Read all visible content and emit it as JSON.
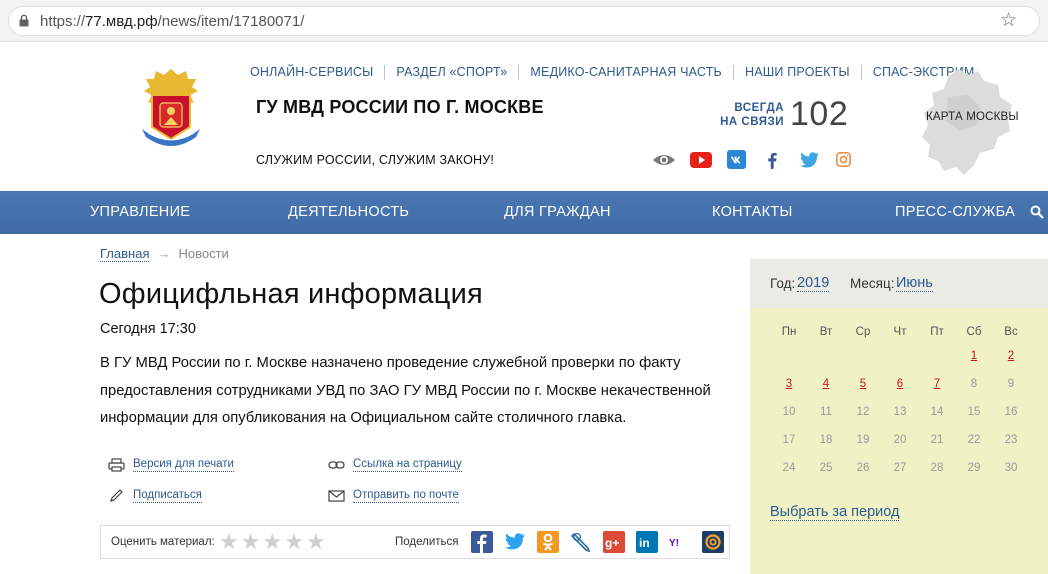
{
  "browser": {
    "url_scheme": "https://",
    "url_host": "77.мвд.рф",
    "url_path": "/news/item/17180071/"
  },
  "header": {
    "top_links": [
      "ОНЛАЙН-СЕРВИСЫ",
      "РАЗДЕЛ «СПОРТ»",
      "МЕДИКО-САНИТАРНАЯ ЧАСТЬ",
      "НАШИ ПРОЕКТЫ",
      "СПАС-ЭКСТРИМ"
    ],
    "title": "ГУ МВД РОССИИ ПО Г. МОСКВЕ",
    "motto": "СЛУЖИМ РОССИИ, СЛУЖИМ ЗАКОНУ!",
    "always_line1": "ВСЕГДА",
    "always_line2": "НА СВЯЗИ",
    "phone": "102",
    "map_label": "КАРТА МОСКВЫ"
  },
  "nav": {
    "items": [
      "УПРАВЛЕНИЕ",
      "ДЕЯТЕЛЬНОСТЬ",
      "ДЛЯ ГРАЖДАН",
      "КОНТАКТЫ",
      "ПРЕСС-СЛУЖБА"
    ]
  },
  "breadcrumb": {
    "home": "Главная",
    "arrow": "→",
    "current": "Новости"
  },
  "article": {
    "title": "Официфльная информация",
    "date": "Сегодня 17:30",
    "body": "В ГУ МВД России по г. Москве назначено проведение служебной проверки по факту предоставления сотрудниками УВД по ЗАО ГУ МВД России по г. Москве некачественной информации для опубликования на Официальном сайте столичного главка."
  },
  "actions": {
    "print": "Версия для печати",
    "link": "Ссылка на страницу",
    "subscribe": "Подписаться",
    "email": "Отправить по почте"
  },
  "rating": {
    "label": "Оценить материал:",
    "stars": 5,
    "share_label": "Поделиться"
  },
  "calendar": {
    "year_label": "Год:",
    "year": "2019",
    "month_label": "Месяц:",
    "month": "Июнь",
    "weekdays": [
      "Пн",
      "Вт",
      "Ср",
      "Чт",
      "Пт",
      "Сб",
      "Вс"
    ],
    "weeks": [
      [
        "",
        "",
        "",
        "",
        "",
        "1",
        "2"
      ],
      [
        "3",
        "4",
        "5",
        "6",
        "7",
        "8",
        "9"
      ],
      [
        "10",
        "11",
        "12",
        "13",
        "14",
        "15",
        "16"
      ],
      [
        "17",
        "18",
        "19",
        "20",
        "21",
        "22",
        "23"
      ],
      [
        "24",
        "25",
        "26",
        "27",
        "28",
        "29",
        "30"
      ]
    ],
    "linked_days": [
      "1",
      "2",
      "3",
      "4",
      "5",
      "6",
      "7"
    ],
    "period_link": "Выбрать за период"
  },
  "colors": {
    "nav": "#4675b0",
    "link": "#2e5a8e",
    "calendar_bg": "#f0f2c6",
    "day_link": "#c8102e"
  }
}
